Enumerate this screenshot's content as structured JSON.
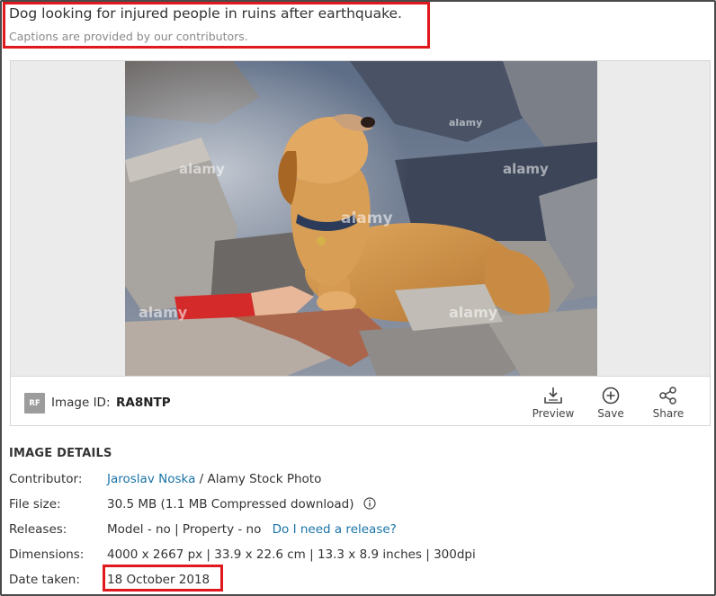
{
  "caption": {
    "title": "Dog looking for injured people in ruins after earthquake.",
    "subtitle": "Captions are provided by our contributors."
  },
  "image": {
    "license_badge": "RF",
    "id_label": "Image ID:",
    "id_value": "RA8NTP",
    "watermark": "alamy"
  },
  "actions": {
    "preview": "Preview",
    "save": "Save",
    "share": "Share"
  },
  "details": {
    "heading": "IMAGE DETAILS",
    "contributor_label": "Contributor:",
    "contributor_name": "Jaroslav Noska",
    "contributor_suffix": "/ Alamy Stock Photo",
    "filesize_label": "File size:",
    "filesize_value": "30.5 MB (1.1 MB Compressed download)",
    "releases_label": "Releases:",
    "releases_value": "Model - no | Property - no",
    "releases_link": "Do I need a release?",
    "dimensions_label": "Dimensions:",
    "dimensions_value": "4000 x 2667 px | 33.9 x 22.6 cm | 13.3 x 8.9 inches | 300dpi",
    "date_label": "Date taken:",
    "date_value": "18 October 2018"
  },
  "colors": {
    "highlight": "#e0191f",
    "link": "#1a73a8",
    "badge": "#9c9c9c"
  }
}
